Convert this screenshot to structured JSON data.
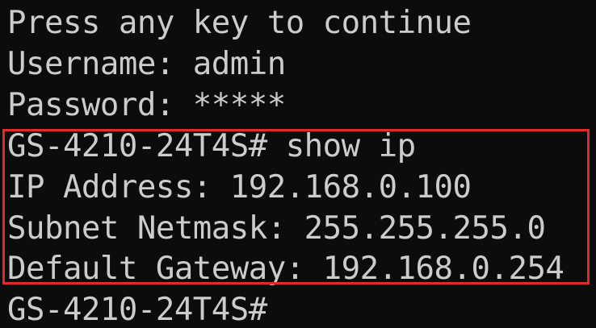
{
  "terminal": {
    "lines": [
      "Press any key to continue",
      "Username: admin",
      "Password: *****",
      "GS-4210-24T4S# show ip",
      "IP Address: 192.168.0.100",
      "Subnet Netmask: 255.255.255.0",
      "Default Gateway: 192.168.0.254",
      "GS-4210-24T4S#"
    ]
  },
  "colors": {
    "background": "#0c0c0c",
    "text": "#cccccc",
    "highlight_border": "#e02b2b"
  }
}
